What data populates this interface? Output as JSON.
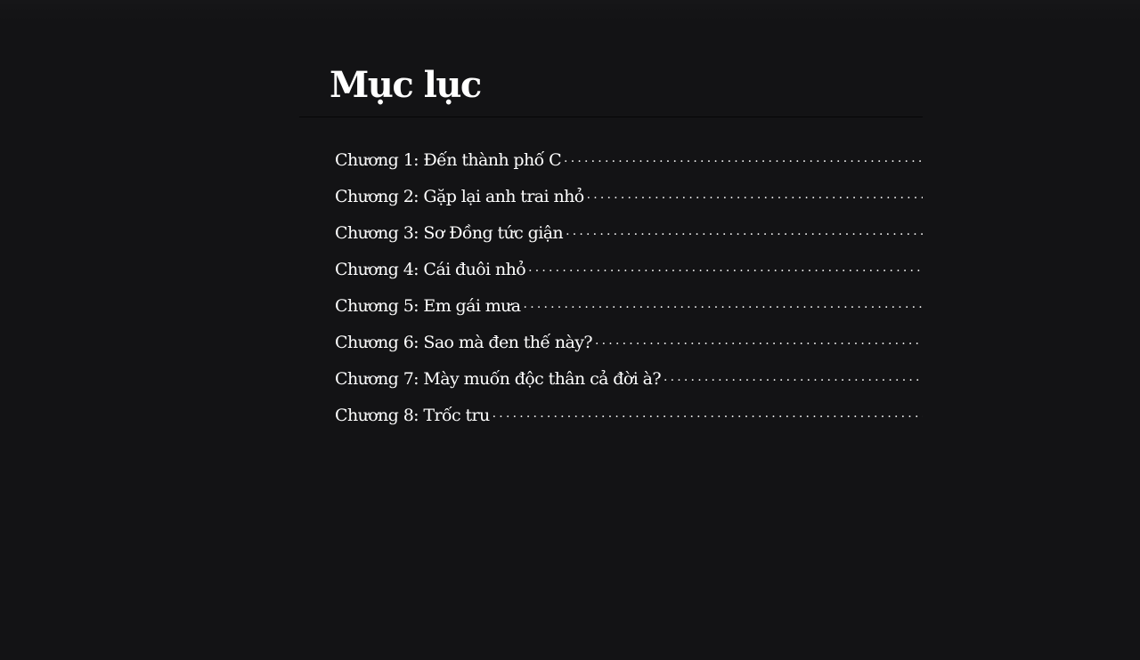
{
  "toc": {
    "title": "Mục lục",
    "chapters": [
      {
        "label": "Chương 1: Đến thành phố C"
      },
      {
        "label": "Chương 2: Gặp lại anh trai nhỏ"
      },
      {
        "label": "Chương 3: Sơ Đồng tức giận"
      },
      {
        "label": "Chương 4: Cái đuôi nhỏ"
      },
      {
        "label": "Chương 5: Em gái mưa"
      },
      {
        "label": "Chương 6: Sao mà đen thế này?"
      },
      {
        "label": "Chương 7: Mày muốn độc thân cả đời à?"
      },
      {
        "label": "Chương 8: Trốc tru"
      }
    ]
  },
  "colors": {
    "background": "#131315",
    "text": "#ffffff"
  }
}
